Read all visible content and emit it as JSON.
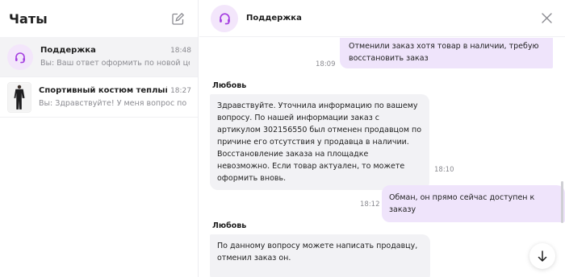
{
  "sidebar": {
    "title": "Чаты",
    "chats": [
      {
        "name": "Поддержка",
        "time": "18:48",
        "preview": "Вы: Ваш ответ оформить по новой цене"
      },
      {
        "name": "Спортивный костюм теплый с начёсом",
        "time": "18:27",
        "preview": "Вы: Здравствуйте! У меня вопрос по товару"
      }
    ]
  },
  "chat": {
    "title": "Поддержка",
    "messages": [
      {
        "text": "Отменили заказ хотя товар в наличии, требую восстановить заказ",
        "time": "18:09"
      },
      {
        "author": "Любовь",
        "text": "Здравствуйте. Уточнила информацию по вашему вопросу. По нашей информации заказ с артикулом 302156550 был отменен продавцом по причине его отсутствия у продавца в наличии. Восстановление заказа на площадке невозможно. Если товар актуален, то можете оформить вновь.",
        "time": "18:10"
      },
      {
        "text": "Обман, он прямо сейчас доступен к заказу",
        "time": "18:12"
      },
      {
        "author": "Любовь",
        "text": "По данному вопросу можете написать продавцу, отменил заказ он."
      }
    ]
  },
  "colors": {
    "accent": "#a43ee0",
    "bubble_out": "#efe4fb",
    "bubble_in": "#f2f2f5"
  }
}
